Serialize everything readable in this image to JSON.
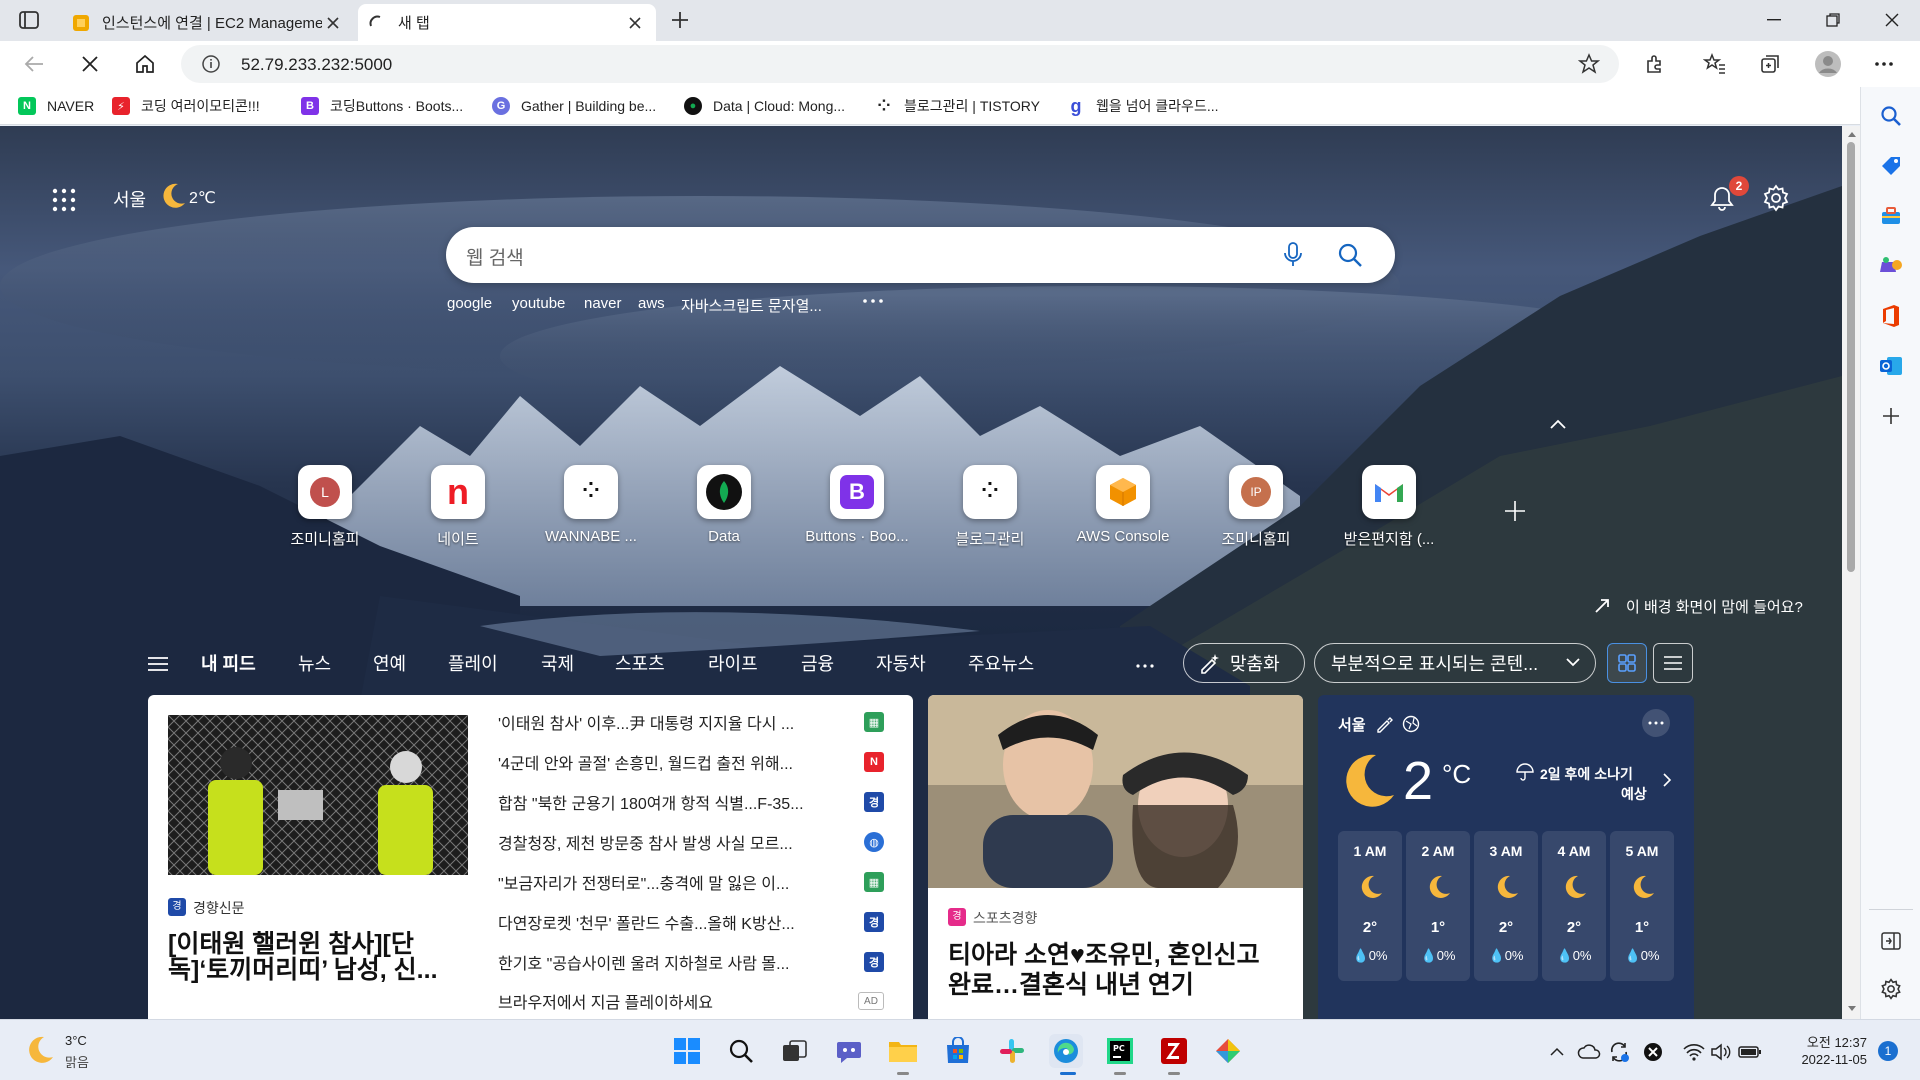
{
  "tabs": [
    {
      "title": "인스턴스에 연결 | EC2 Management Console",
      "active": false
    },
    {
      "title": "새 탭",
      "active": true
    }
  ],
  "address": {
    "url": "52.79.233.232:5000"
  },
  "bookmarks": [
    {
      "label": "NAVER",
      "icon": "N",
      "color": "#03c75a"
    },
    {
      "label": "코딩 여러이모티콘!!!",
      "icon": "⚡",
      "color": "#e8232c"
    },
    {
      "label": "코딩Buttons · Boots...",
      "icon": "B",
      "color": "#7f32e8"
    },
    {
      "label": "Gather | Building be...",
      "icon": "G",
      "color": "#6a70e0"
    },
    {
      "label": "Data | Cloud: Mong...",
      "icon": "●",
      "color": "#1a1a1a"
    },
    {
      "label": "블로그관리 | TISTORY",
      "icon": "⁘",
      "color": "#222222"
    },
    {
      "label": "웹을 넘어 클라우드...",
      "icon": "g",
      "color": "#3b4fd8"
    }
  ],
  "ntp": {
    "location": "서울",
    "temp": "2℃",
    "notification_count": "2",
    "search_placeholder": "웹 검색",
    "suggestions": [
      "google",
      "youtube",
      "naver",
      "aws",
      "자바스크립트 문자열..."
    ],
    "background_prompt": "이 배경 화면이 맘에 들어요?",
    "quick_links": [
      {
        "label": "조미니홈피",
        "glyph": "L",
        "color": "#c0504d"
      },
      {
        "label": "네이트",
        "glyph": "n",
        "color": "#ee1c25"
      },
      {
        "label": "WANNABE ...",
        "glyph": "⁘",
        "color": "#111111"
      },
      {
        "label": "Data",
        "glyph": "●",
        "color": "#13aa52"
      },
      {
        "label": "Buttons · Boo...",
        "glyph": "B",
        "color": "#7f32e8"
      },
      {
        "label": "블로그관리",
        "glyph": "⁘",
        "color": "#111111"
      },
      {
        "label": "AWS Console",
        "glyph": "◆",
        "color": "#f29100"
      },
      {
        "label": "조미니홈피",
        "glyph": "IP",
        "color": "#c5704d"
      },
      {
        "label": "받은편지함 (...",
        "glyph": "M",
        "color": "#ea4335"
      }
    ],
    "feed_tabs": [
      "내 피드",
      "뉴스",
      "연예",
      "플레이",
      "국제",
      "스포츠",
      "라이프",
      "금융",
      "자동차",
      "주요뉴스"
    ],
    "personalize_label": "맞춤화",
    "content_display_label": "부분적으로 표시되는 콘텐..."
  },
  "news_card": {
    "source": "경향신문",
    "title": "[이태원 핼러윈 참사][단독]‘토끼머리띠’ 남성, 신...",
    "headlines": [
      {
        "text": "'이태원 참사' 이후...尹 대통령 지지율 다시 ...",
        "icon": "▦",
        "color": "#2e9f5a"
      },
      {
        "text": "'4군데 안와 골절' 손흥민, 월드컵 출전 위해...",
        "icon": "N",
        "color": "#e8232c"
      },
      {
        "text": "합참 \"북한 군용기 180여개 항적 식별...F-35...",
        "icon": "경",
        "color": "#1f4aa8"
      },
      {
        "text": "경찰청장, 제천 방문중 참사 발생 사실 모르...",
        "icon": "◍",
        "color": "#2a6fd6"
      },
      {
        "text": "\"보금자리가 전쟁터로\"...충격에 말 잃은 이...",
        "icon": "▦",
        "color": "#2e9f5a"
      },
      {
        "text": "다연장로켓 '천무' 폴란드 수출...올해 K방산...",
        "icon": "경",
        "color": "#1f4aa8"
      },
      {
        "text": "한기호 \"공습사이렌 울려 지하철로 사람 몰...",
        "icon": "경",
        "color": "#1f4aa8"
      },
      {
        "text": "브라우저에서 지금 플레이하세요",
        "icon": "AD",
        "color": "#ffffff"
      }
    ]
  },
  "sports_card": {
    "source": "스포츠경향",
    "title": "티아라 소연♥조유민, 혼인신고 완료…결혼식 내년 연기"
  },
  "weather": {
    "city": "서울",
    "temp": "2",
    "unit": "°C",
    "forecast_line1": "2일 후에 소나기",
    "forecast_line2": "예상",
    "hours": [
      {
        "time": "1 AM",
        "temp": "2°",
        "rain": "0%"
      },
      {
        "time": "2 AM",
        "temp": "1°",
        "rain": "0%"
      },
      {
        "time": "3 AM",
        "temp": "2°",
        "rain": "0%"
      },
      {
        "time": "4 AM",
        "temp": "2°",
        "rain": "0%"
      },
      {
        "time": "5 AM",
        "temp": "1°",
        "rain": "0%"
      }
    ]
  },
  "taskbar": {
    "weather_temp": "3°C",
    "weather_desc": "맑음",
    "time": "오전 12:37",
    "date": "2022-11-05",
    "badge": "1"
  }
}
